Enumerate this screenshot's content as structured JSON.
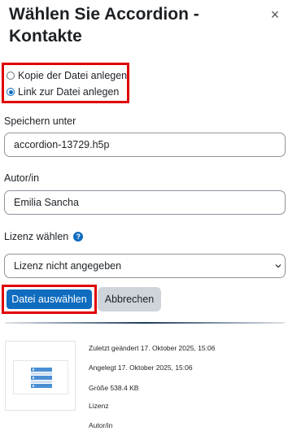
{
  "dialog": {
    "title": "Wählen Sie Accordion - Kontakte",
    "close_label": "×"
  },
  "options": [
    {
      "label": "Kopie der Datei anlegen",
      "checked": false
    },
    {
      "label": "Link zur Datei anlegen",
      "checked": true
    }
  ],
  "save_as": {
    "label": "Speichern unter",
    "value": "accordion-13729.h5p"
  },
  "author": {
    "label": "Autor/in",
    "value": "Emilia Sancha"
  },
  "license": {
    "label": "Lizenz wählen",
    "help": "?",
    "selected": "Lizenz nicht angegeben"
  },
  "buttons": {
    "select": "Datei auswählen",
    "cancel": "Abbrechen"
  },
  "file_info": {
    "modified": "Zuletzt geändert 17. Oktober 2025, 15:06",
    "created": "Angelegt 17. Oktober 2025, 15:06",
    "size": "Größe 538.4 KB",
    "license": "Lizenz",
    "author": "Autor/in"
  },
  "colors": {
    "primary": "#0f6cbf",
    "highlight": "#e00000",
    "secondary": "#ced4da"
  }
}
